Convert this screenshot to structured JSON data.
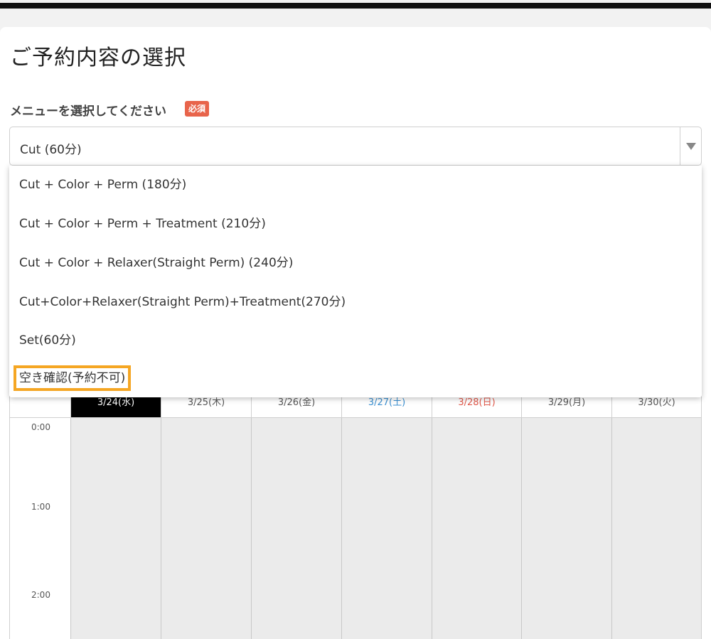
{
  "page": {
    "title": "ご予約内容の選択"
  },
  "menu": {
    "label": "メニューを選択してください",
    "required_badge": "必須",
    "selected_value": "Cut (60分)",
    "options": [
      "Cut + Color + Perm (180分)",
      "Cut + Color + Perm + Treatment (210分)",
      "Cut + Color + Relaxer(Straight Perm) (240分)",
      "Cut+Color+Relaxer(Straight Perm)+Treatment(270分)",
      "Set(60分)",
      "空き確認(予約不可)"
    ],
    "highlighted_option_index": 5,
    "highlight_color": "#f5a623"
  },
  "calendar": {
    "days": [
      {
        "label": "3/24(水)",
        "kind": "today"
      },
      {
        "label": "3/25(木)",
        "kind": "weekday"
      },
      {
        "label": "3/26(金)",
        "kind": "weekday"
      },
      {
        "label": "3/27(土)",
        "kind": "sat"
      },
      {
        "label": "3/28(日)",
        "kind": "sun"
      },
      {
        "label": "3/29(月)",
        "kind": "weekday"
      },
      {
        "label": "3/30(火)",
        "kind": "weekday"
      }
    ],
    "times": [
      "0:00",
      "1:00",
      "2:00"
    ],
    "colors": {
      "today_bg": "#000000",
      "saturday": "#3a8fd0",
      "sunday": "#e0584a",
      "closed_cell": "#ebebeb"
    }
  }
}
